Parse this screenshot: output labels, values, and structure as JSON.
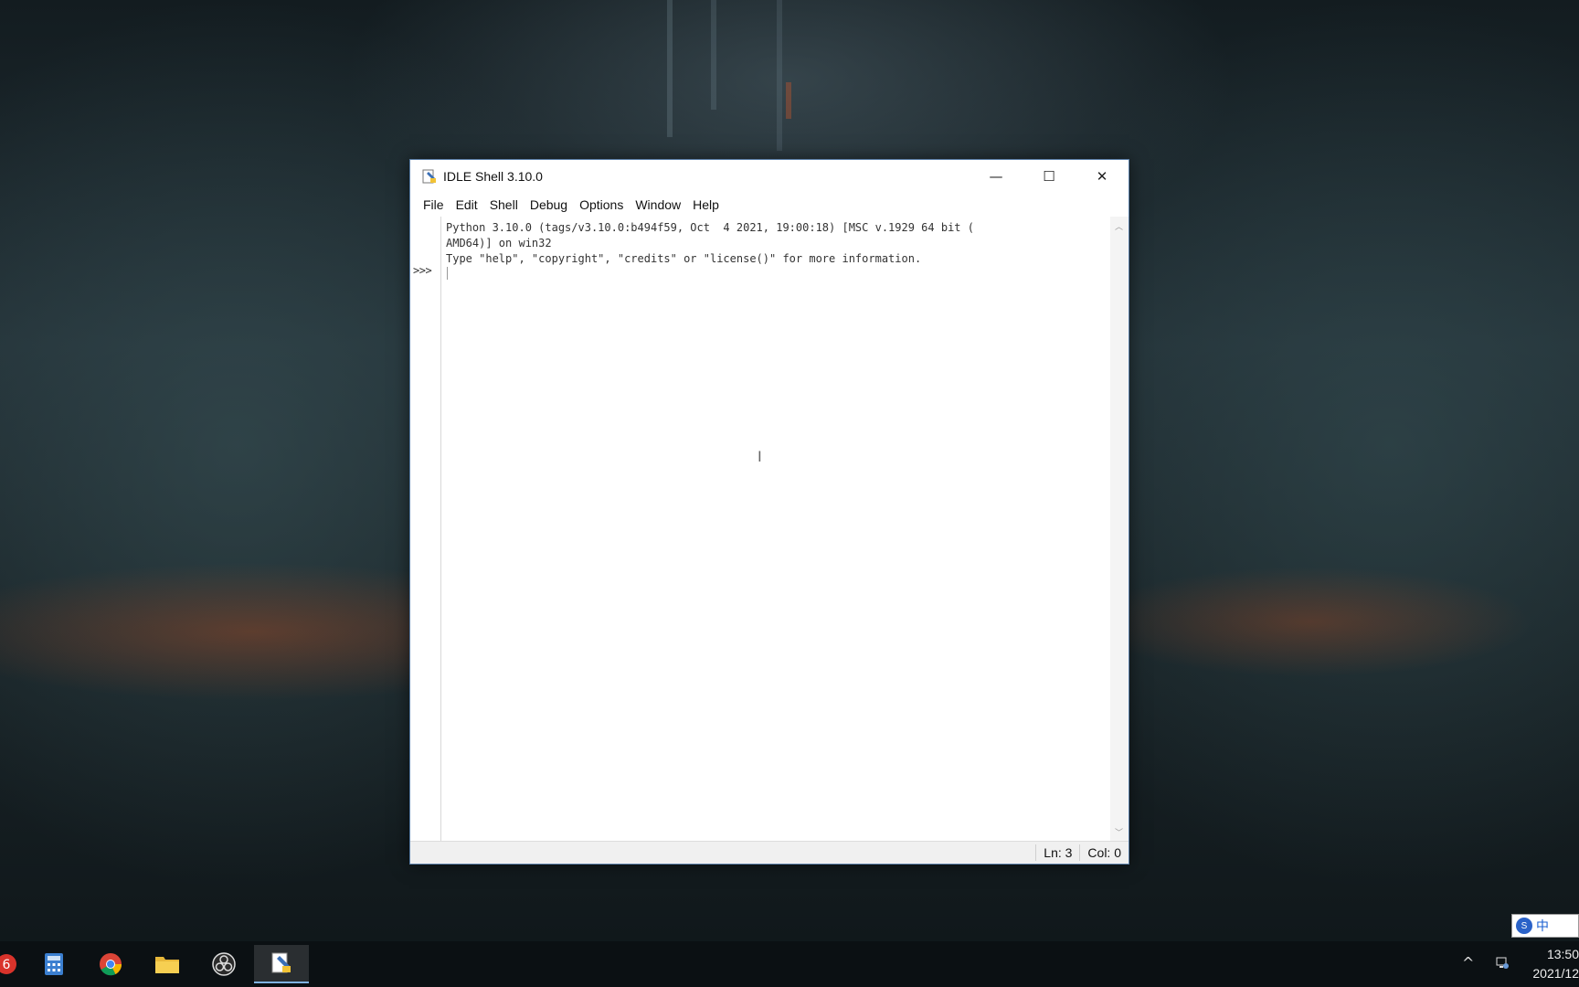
{
  "window": {
    "title": "IDLE Shell 3.10.0",
    "controls": {
      "minimize": "—",
      "maximize": "☐",
      "close": "✕"
    }
  },
  "menubar": {
    "items": [
      "File",
      "Edit",
      "Shell",
      "Debug",
      "Options",
      "Window",
      "Help"
    ]
  },
  "shell": {
    "lines": [
      "Python 3.10.0 (tags/v3.10.0:b494f59, Oct  4 2021, 19:00:18) [MSC v.1929 64 bit (",
      "AMD64)] on win32",
      "Type \"help\", \"copyright\", \"credits\" or \"license()\" for more information."
    ],
    "prompt": ">>>"
  },
  "statusbar": {
    "line": "Ln: 3",
    "col": "Col: 0"
  },
  "taskbar": {
    "apps": [
      "app-icon",
      "calculator-icon",
      "chrome-icon",
      "file-explorer-icon",
      "obs-icon",
      "idle-icon"
    ],
    "clock_time": "13:50",
    "clock_date": "2021/12"
  },
  "ime": {
    "mode": "中"
  }
}
